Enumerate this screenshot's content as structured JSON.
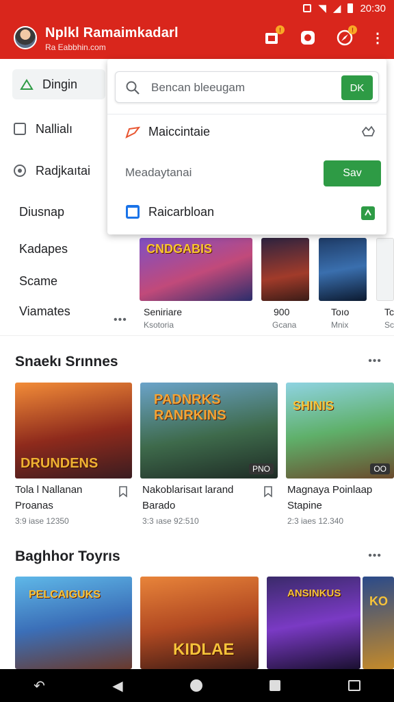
{
  "status": {
    "time": "20:30"
  },
  "app": {
    "title": "Nplkl Ramaimkadarl",
    "subtitle": "Ra Eabbhin.com"
  },
  "sidebar": {
    "items": [
      {
        "label": "Dingin"
      },
      {
        "label": "Nallialı"
      },
      {
        "label": "Radjkaıtai"
      },
      {
        "label": "Diusnap"
      },
      {
        "label": "Kadapes"
      },
      {
        "label": "Scame"
      },
      {
        "label": "Viamates"
      }
    ]
  },
  "dropdown": {
    "search_placeholder": "Bencan bleeugam",
    "ok_label": "DK",
    "item1": "Maiccintaie",
    "item2": "Meadaytanai",
    "save_label": "Sav",
    "item3": "Raicarbloan"
  },
  "featured": [
    {
      "art": "CNDGABIS",
      "title": "Seniriare",
      "sub": "Ksotoria"
    },
    {
      "title": "900",
      "sub": "Gcana"
    },
    {
      "title": "Toıo",
      "sub": "Mnix"
    },
    {
      "title": "Tc",
      "sub": "Sc"
    }
  ],
  "section1": {
    "title": "Snaekı Srınnes",
    "cards": [
      {
        "art": "DRUNDENS",
        "line1": "Tola l Nallanan",
        "line2": "Proanas",
        "meta": "3:9 iase 12350"
      },
      {
        "art": "PADNRKS RANRKINS",
        "badge": "PNO",
        "line1": "Nakoblarisaıt larand",
        "line2": "Barado",
        "meta": "3:3 ıase 92:510"
      },
      {
        "art": "SHINIS",
        "badge": "OO",
        "line1": "Magnaya Poinlaap",
        "line2": "Stapine",
        "meta": "2:3 iaes 12.340"
      }
    ]
  },
  "section2": {
    "title": "Baghhor Toyrıs",
    "cards": [
      {
        "art": "PELCAIGUKS"
      },
      {
        "art": "KIDLAE"
      },
      {
        "art": "ANSINKUS"
      },
      {
        "art": "KO"
      }
    ]
  }
}
